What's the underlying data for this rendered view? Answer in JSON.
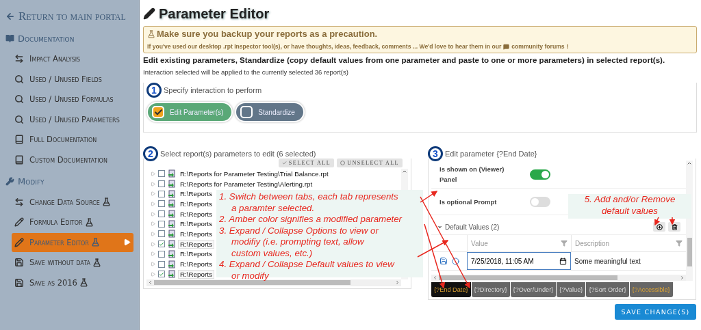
{
  "sidebar": {
    "back_link": "Return to main portal",
    "groups": [
      {
        "title": "Documentation",
        "items": [
          {
            "label": "Impact Analysis",
            "experimental": false,
            "selected": false
          },
          {
            "label": "Used / Unused Fields",
            "experimental": false,
            "selected": false
          },
          {
            "label": "Used / Unused Formulas",
            "experimental": false,
            "selected": false
          },
          {
            "label": "Used / Unused Parameters",
            "experimental": false,
            "selected": false
          },
          {
            "label": "Full Documentation",
            "experimental": false,
            "selected": false
          },
          {
            "label": "Custom Documentation",
            "experimental": false,
            "selected": false
          }
        ]
      },
      {
        "title": "Modify",
        "items": [
          {
            "label": "Change Data Source",
            "experimental": true,
            "selected": false
          },
          {
            "label": "Formula Editor",
            "experimental": true,
            "selected": false
          },
          {
            "label": "Parameter Editor",
            "experimental": true,
            "selected": true
          },
          {
            "label": "Save without data",
            "experimental": true,
            "selected": false
          },
          {
            "label": "Save as 2016",
            "experimental": true,
            "selected": false
          }
        ]
      }
    ]
  },
  "page_title": "Parameter Editor",
  "alert": {
    "title": "Make sure you backup your reports as a precaution.",
    "message": "If you've used our desktop .rpt Inspector tool(s), or have thoughts, ideas, feedback, comments ... We'd love to hear them in our",
    "link": "community forums",
    "end": "!"
  },
  "intro": "Edit existing parameters, Standardize (copy default values from one parameter and paste to one or more parameters) in selected report(s).",
  "note": "Interaction selected will be applied to the currently selected 36 report(s)",
  "step1": {
    "number": "1",
    "title": "Specify interaction to perform",
    "options": [
      {
        "label": "Edit Parameter(s)",
        "selected": true
      },
      {
        "label": "Standardize",
        "selected": false
      }
    ]
  },
  "step2": {
    "number": "2",
    "title": "Select report(s) parameters to edit (6 selected)",
    "select_all": "SELECT ALL",
    "unselect_all": "UNSELECT ALL",
    "reports": [
      {
        "path": "R:\\Reports for Parameter Testing\\Trial Balance.rpt",
        "checked": false
      },
      {
        "path": "R:\\Reports for Parameter Testing\\Alerting.rpt",
        "checked": false
      },
      {
        "path": "R:\\Reports",
        "checked": false
      },
      {
        "path": "R:\\Reports",
        "checked": false
      },
      {
        "path": "R:\\Reports",
        "checked": false
      },
      {
        "path": "R:\\Reports",
        "checked": false
      },
      {
        "path": "R:\\Reports",
        "checked": false
      },
      {
        "path": "R:\\Reports",
        "checked": true
      },
      {
        "path": "R:\\Reports",
        "checked": false
      },
      {
        "path": "R:\\Reports",
        "checked": false
      },
      {
        "path": "R:\\Reports",
        "checked": true
      }
    ]
  },
  "step3": {
    "number": "3",
    "title": "Edit parameter {?End Date}",
    "options": [
      {
        "label": "Is shown on (Viewer) Panel",
        "on": true
      },
      {
        "label": "Is optional Prompt",
        "on": false
      }
    ],
    "default_values": {
      "title": "Default Values (2)",
      "expanded": true,
      "columns": [
        "Value",
        "Description"
      ],
      "rows": [
        {
          "value": "7/25/2018, 11:05 AM",
          "description": "Some meaningful text"
        }
      ]
    },
    "tabs": [
      {
        "label": "{?End Date}",
        "selected": true,
        "modified": true
      },
      {
        "label": "{?Directory}",
        "selected": false,
        "modified": false
      },
      {
        "label": "{?Over/Under}",
        "selected": false,
        "modified": false
      },
      {
        "label": "{?Value}",
        "selected": false,
        "modified": false
      },
      {
        "label": "{?Sort Order}",
        "selected": false,
        "modified": false
      },
      {
        "label": "{?Accessible}",
        "selected": false,
        "modified": true
      }
    ]
  },
  "save_button": "SAVE CHANGE(S)",
  "annotations": {
    "main": [
      "1. Switch between tabs, each tab represents",
      "a paramter selected.",
      "2. Amber color signifies a modified parameter",
      "3. Expand / Collapse Options to view or",
      "modifiy (i.e. prompting text, allow",
      "custom values, etc.)",
      "4. Expand / Collapse Default values to view",
      "or modify"
    ],
    "side": [
      "5. Add and/or Remove",
      "default values"
    ]
  }
}
